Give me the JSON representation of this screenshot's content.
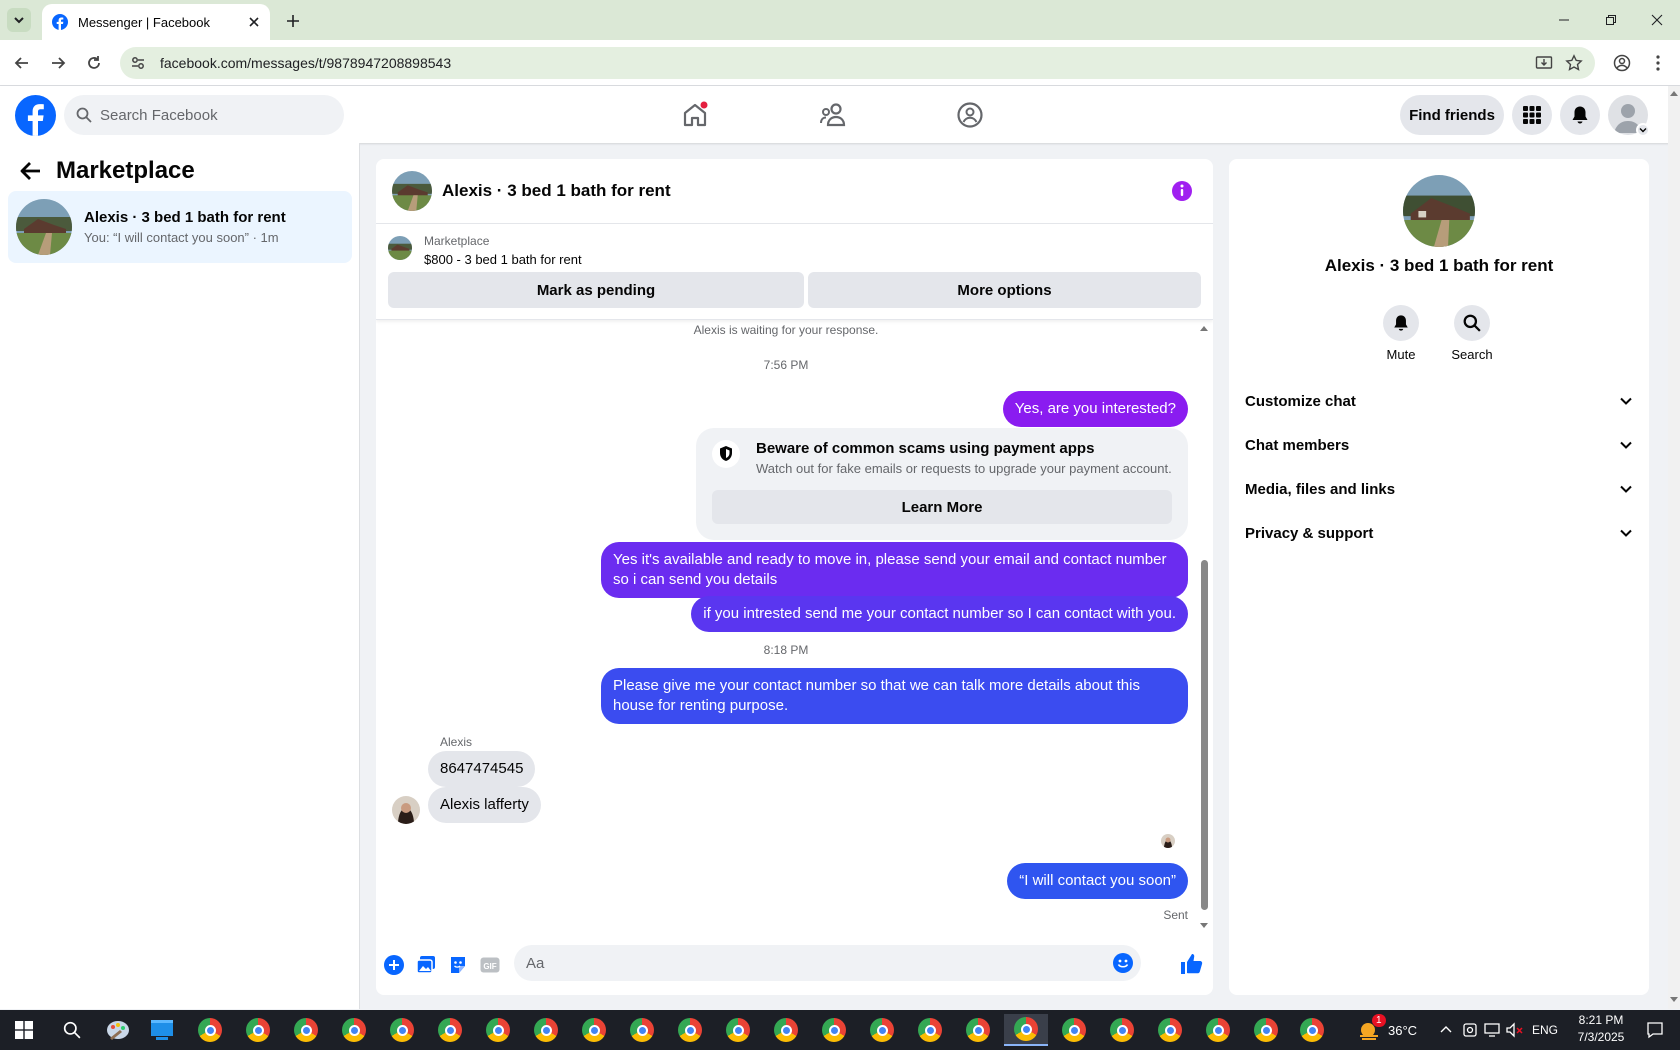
{
  "browser": {
    "tab_title": "Messenger | Facebook",
    "url": "facebook.com/messages/t/9878947208898543"
  },
  "fb": {
    "search_placeholder": "Search Facebook",
    "find_friends": "Find friends"
  },
  "sidebar": {
    "title": "Marketplace",
    "conversation": {
      "name": "Alexis · 3 bed 1 bath for rent",
      "preview": "You: “I will contact you soon” · 1m"
    }
  },
  "chat": {
    "title": "Alexis · 3 bed 1 bath for rent",
    "listing_category": "Marketplace",
    "listing_title": "$800 - 3 bed 1 bath for rent",
    "mark_pending": "Mark as pending",
    "more_options": "More options",
    "waiting_notice": "Alexis is waiting for your response.",
    "time1": "7:56 PM",
    "msg1": "Yes, are you interested?",
    "scam_title": "Beware of common scams using payment apps",
    "scam_desc": "Watch out for fake emails or requests to upgrade your payment account.",
    "learn_more": "Learn More",
    "msg2": "Yes it's available and ready to move in, please send your email and contact number so i can send you details",
    "msg3": "if you intrested send me your contact number so I can contact with you.",
    "time2": "8:18 PM",
    "msg4": "Please give me your contact number so that we can talk more details about this house for renting purpose.",
    "sender": "Alexis",
    "recv1": "8647474545",
    "recv2": "Alexis lafferty",
    "msg5": "“I will contact you soon”",
    "sent_status": "Sent",
    "input_placeholder": "Aa"
  },
  "details": {
    "name": "Alexis · 3 bed 1 bath for rent",
    "mute": "Mute",
    "search": "Search",
    "sections": [
      "Customize chat",
      "Chat members",
      "Media, files and links",
      "Privacy & support"
    ]
  },
  "taskbar": {
    "temperature": "36°C",
    "language": "ENG",
    "time": "8:21 PM",
    "date": "7/3/2025",
    "weather_badge": "1"
  },
  "colors": {
    "fb_blue": "#0866ff",
    "bubble_purple": "#8a1cf0",
    "bubble_blue": "#3b4cf0",
    "info_purple": "#a020f0"
  }
}
